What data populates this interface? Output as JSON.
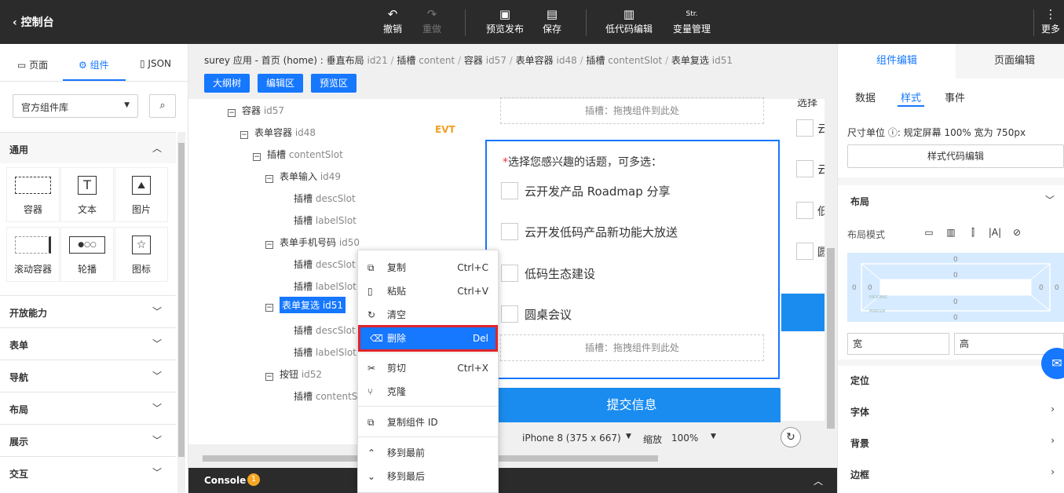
{
  "topbar": {
    "back_label": "控制台",
    "undo": "撤销",
    "redo": "重做",
    "preview": "预览发布",
    "save": "保存",
    "lowcode": "低代码编辑",
    "vars": "变量管理",
    "more": "更多",
    "vars_icon": "Str."
  },
  "left": {
    "tab_page": "页面",
    "tab_components": "组件",
    "tab_json": "JSON",
    "library": "官方组件库",
    "sec_general": "通用",
    "components": [
      {
        "label": "容器"
      },
      {
        "label": "文本"
      },
      {
        "label": "图片"
      },
      {
        "label": "滚动容器"
      },
      {
        "label": "轮播"
      },
      {
        "label": "图标"
      }
    ],
    "sections": [
      "开放能力",
      "表单",
      "导航",
      "布局",
      "展示",
      "交互"
    ]
  },
  "center": {
    "breadcrumb": [
      {
        "t": "surey 应用 - 首页 (home) : 垂直布局",
        "id": "id21"
      },
      {
        "t": "插槽",
        "id": "content"
      },
      {
        "t": "容器",
        "id": "id57"
      },
      {
        "t": "表单容器",
        "id": "id48"
      },
      {
        "t": "插槽",
        "id": "contentSlot"
      },
      {
        "t": "表单复选",
        "id": "id51"
      }
    ],
    "btn_outline": "大纲树",
    "btn_edit": "编辑区",
    "btn_preview": "预览区",
    "tree": [
      {
        "label": "容器",
        "id": "id57"
      },
      {
        "label": "表单容器",
        "id": "id48"
      },
      {
        "label": "插槽",
        "id": "contentSlot"
      },
      {
        "label": "表单输入",
        "id": "id49"
      },
      {
        "label": "插槽",
        "id": "descSlot"
      },
      {
        "label": "插槽",
        "id": "labelSlot"
      },
      {
        "label": "表单手机号码",
        "id": "id50"
      },
      {
        "label": "插槽",
        "id": "descSlot"
      },
      {
        "label": "插槽",
        "id": "labelSlot"
      },
      {
        "label": "表单复选",
        "id": "id51"
      },
      {
        "label": "插槽",
        "id": "descSlot"
      },
      {
        "label": "插槽",
        "id": "labelSlot"
      },
      {
        "label": "按钮",
        "id": "id52"
      },
      {
        "label": "插槽",
        "id": "contentSl"
      }
    ],
    "evt": "EVT",
    "drop_hint": "插槽：拖拽组件到此处",
    "question_star": "*",
    "question": "选择您感兴趣的话题，可多选：",
    "options": [
      "云开发产品 Roadmap 分享",
      "云开发低码产品新功能大放送",
      "低码生态建设",
      "圆桌会议"
    ],
    "submit": "提交信息",
    "device": "iPhone 8 (375 x 667)",
    "zoom_label": "缩放",
    "zoom": "100%",
    "peek_texts": [
      "选择",
      "云",
      "云",
      "低",
      "圆"
    ],
    "console": "Console",
    "console_count": "1"
  },
  "menu": [
    {
      "label": "复制",
      "shortcut": "Ctrl+C",
      "icon": "copy-icon"
    },
    {
      "label": "粘贴",
      "shortcut": "Ctrl+V",
      "icon": "paste-icon"
    },
    {
      "label": "清空",
      "shortcut": "",
      "icon": "refresh-icon"
    },
    {
      "label": "删除",
      "shortcut": "Del",
      "icon": "delete-icon"
    },
    {
      "label": "剪切",
      "shortcut": "Ctrl+X",
      "icon": "scissors-icon"
    },
    {
      "label": "克隆",
      "shortcut": "",
      "icon": "branch-icon"
    },
    {
      "label": "复制组件 ID",
      "shortcut": "",
      "icon": "copy-icon"
    },
    {
      "label": "移到最前",
      "shortcut": "",
      "icon": "double-up-icon"
    },
    {
      "label": "移到最后",
      "shortcut": "",
      "icon": "double-down-icon"
    }
  ],
  "right": {
    "tab_component": "组件编辑",
    "tab_page": "页面编辑",
    "sub_data": "数据",
    "sub_style": "样式",
    "sub_event": "事件",
    "unit": "尺寸单位 ⓘ: 规定屏幕 100% 宽为 750px",
    "code_btn": "样式代码编辑",
    "layout": "布局",
    "layout_mode": "布局模式",
    "box_zero": "0",
    "box_padding": "PADDING",
    "box_margin": "MARGIN",
    "width": "宽",
    "height": "高",
    "positioning": "定位",
    "font": "字体",
    "background": "背景",
    "border": "边框"
  },
  "colors": {
    "accent": "#1677ff",
    "highlight": "#e0242b",
    "topbar": "#2b2b2b"
  }
}
